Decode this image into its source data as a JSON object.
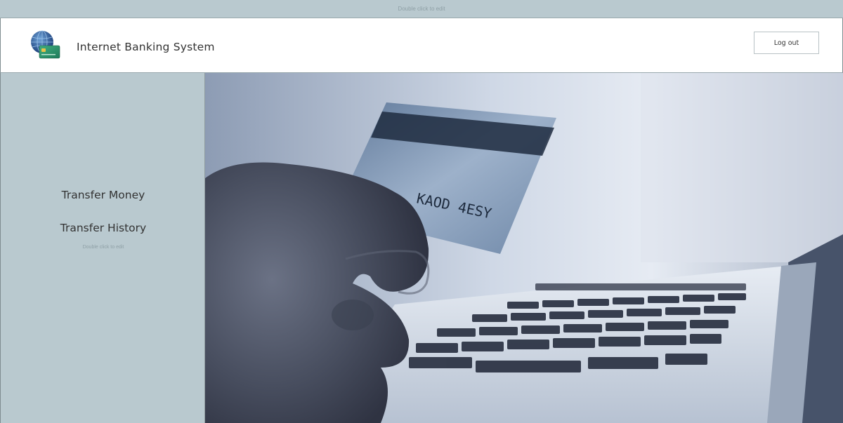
{
  "top_bar": {
    "edit_hint": "Double click to edit"
  },
  "header": {
    "title": "Internet Banking System",
    "logout_label": "Log out"
  },
  "sidebar": {
    "items": [
      {
        "label": "Transfer Money"
      },
      {
        "label": "Transfer History"
      }
    ],
    "edit_hint": "Double click to edit"
  },
  "hero": {
    "image": "hand-holding-credit-card-over-laptop",
    "card_text": "KAOD 4ESY"
  },
  "colors": {
    "sidebar_bg": "#b9c9cf",
    "header_bg": "#ffffff",
    "text": "#333333"
  }
}
